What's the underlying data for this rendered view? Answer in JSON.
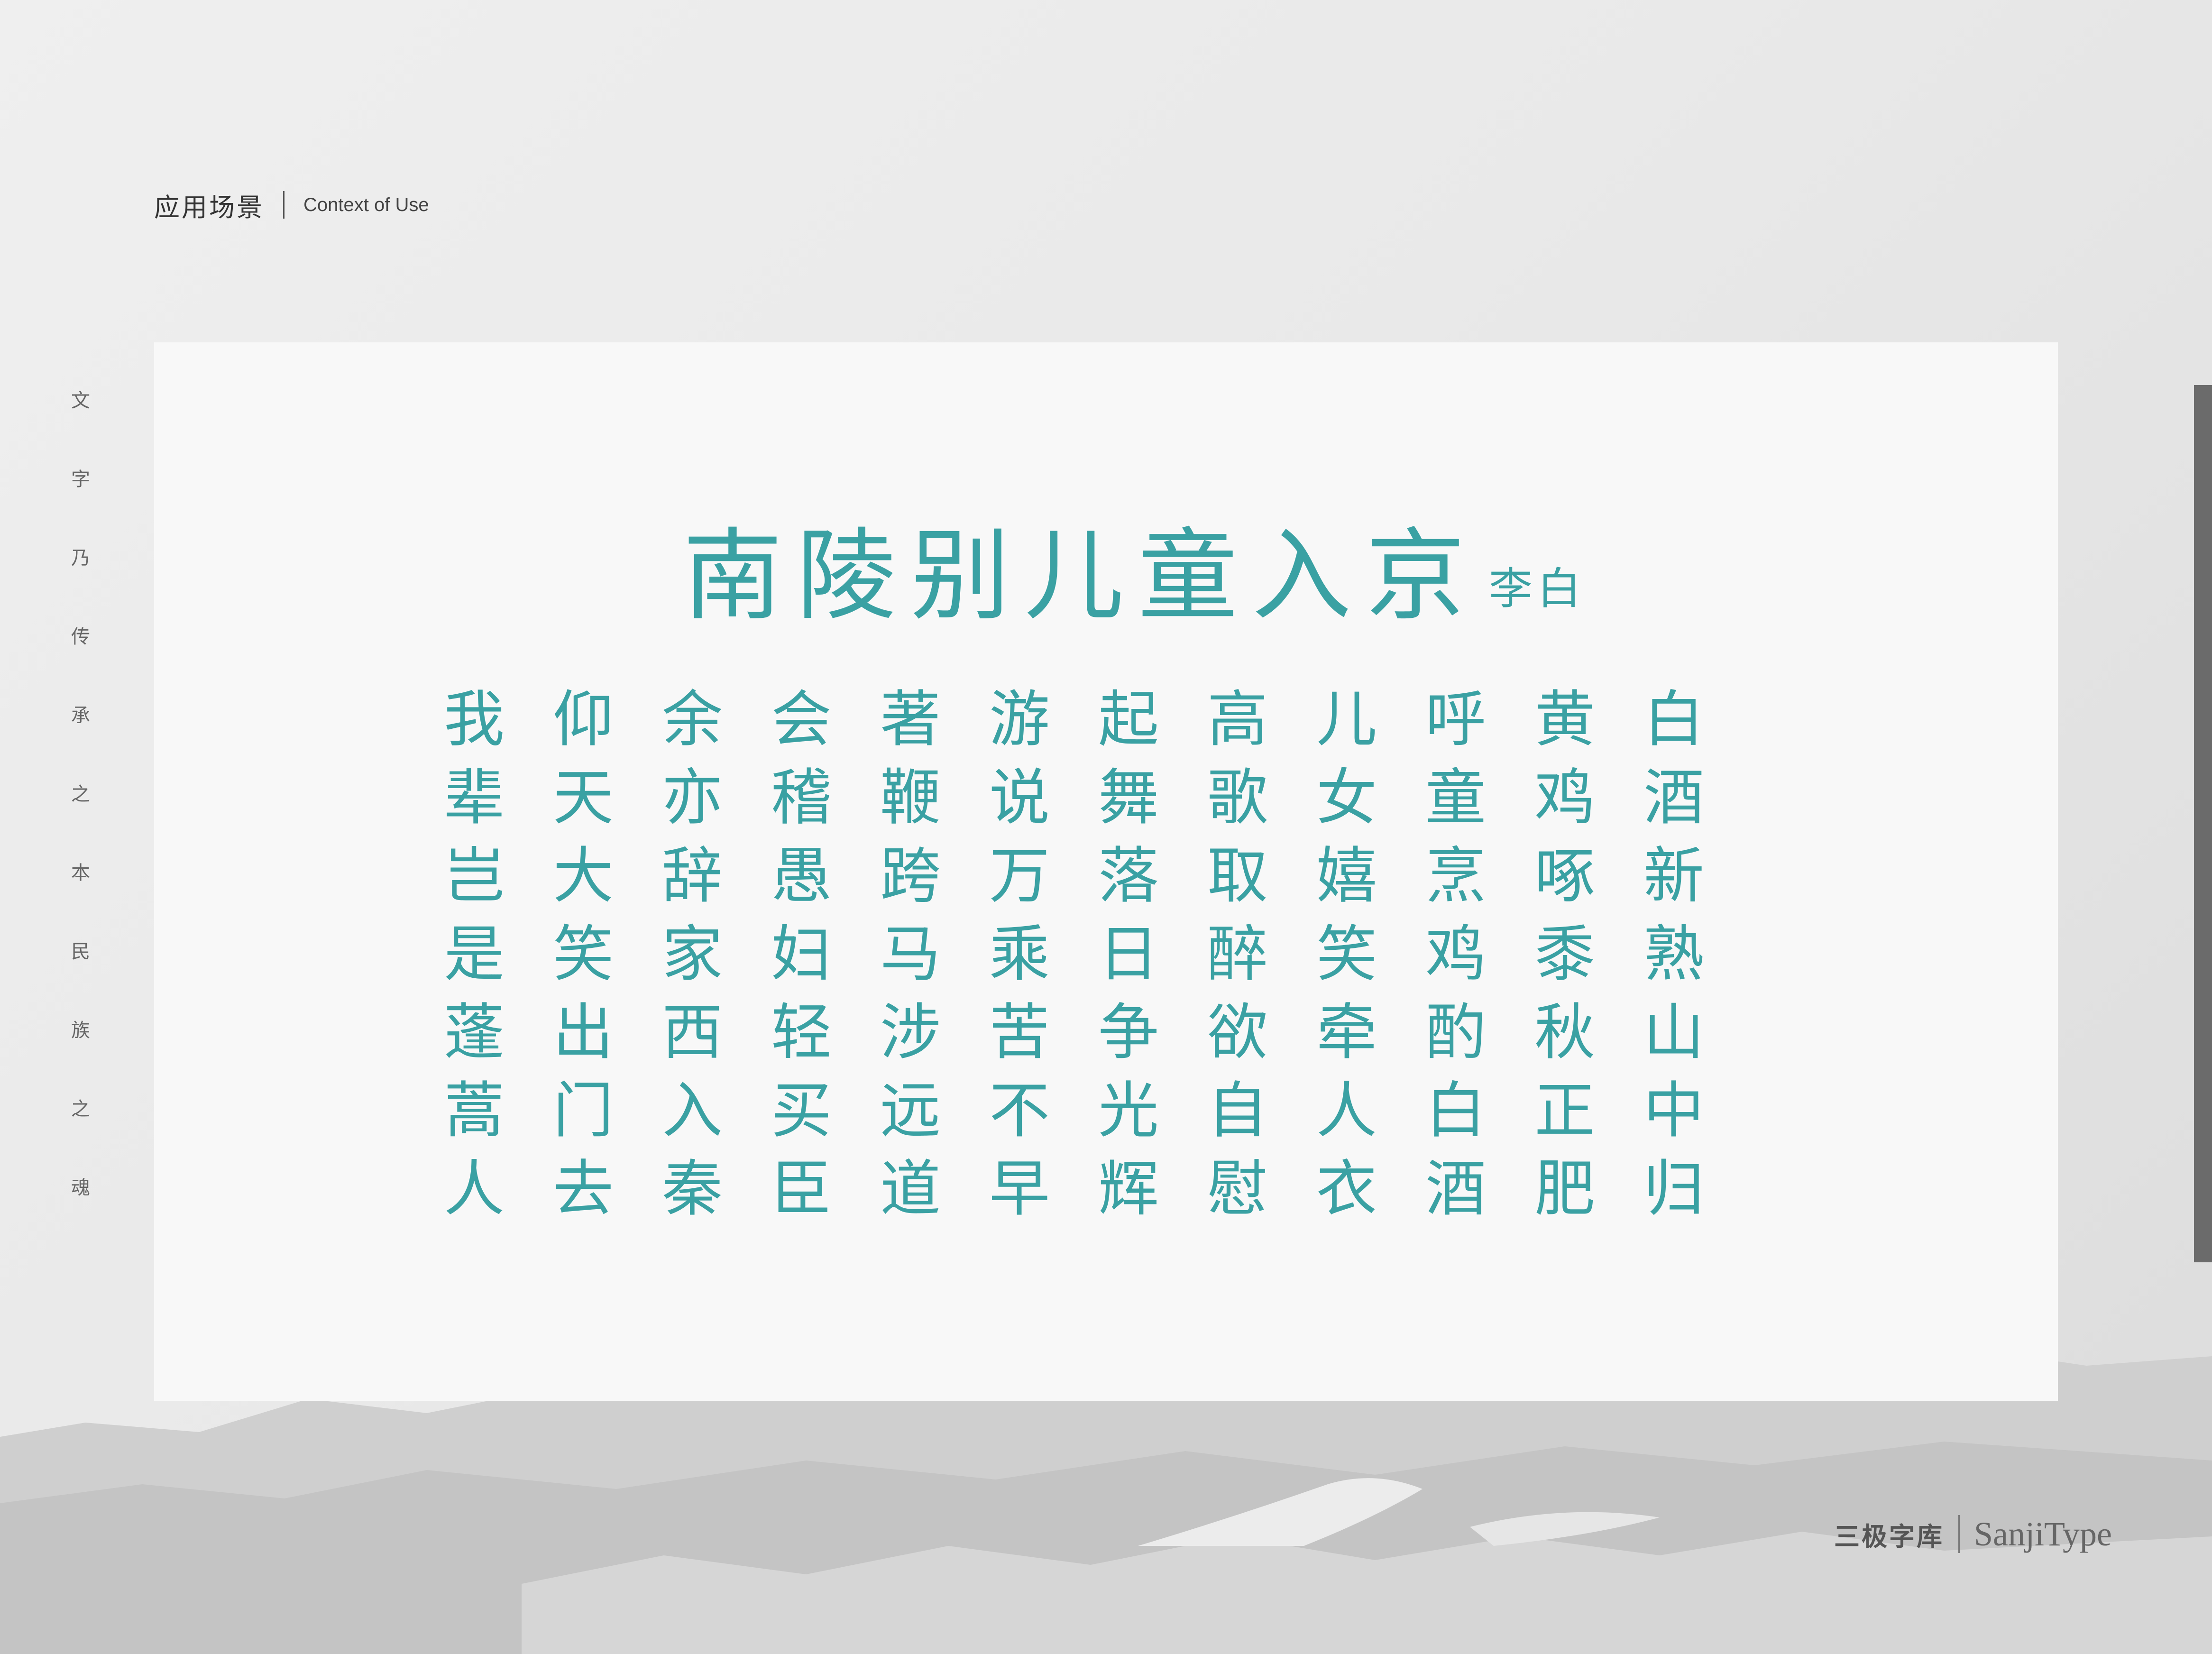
{
  "header": {
    "title_zh": "应用场景",
    "title_en": "Context of Use"
  },
  "side_motto": [
    "文",
    "字",
    "乃",
    "传",
    "承",
    "之",
    "本",
    "民",
    "族",
    "之",
    "魂"
  ],
  "poem": {
    "title": "南陵别儿童入京",
    "author": "李白",
    "columns": [
      "白酒新熟山中归",
      "黄鸡啄黍秋正肥",
      "呼童烹鸡酌白酒",
      "儿女嬉笑牵人衣",
      "高歌取醉欲自慰",
      "起舞落日争光辉",
      "游说万乘苦不早",
      "著鞭跨马涉远道",
      "会稽愚妇轻买臣",
      "余亦辞家西入秦",
      "仰天大笑出门去",
      "我辈岂是蓬蒿人"
    ]
  },
  "brand": {
    "zh": "三极字库",
    "en": "SanjiType"
  },
  "colors": {
    "poem_text": "#3aa1a3",
    "background": "#e9e9e9",
    "card": "#f8f8f8"
  }
}
